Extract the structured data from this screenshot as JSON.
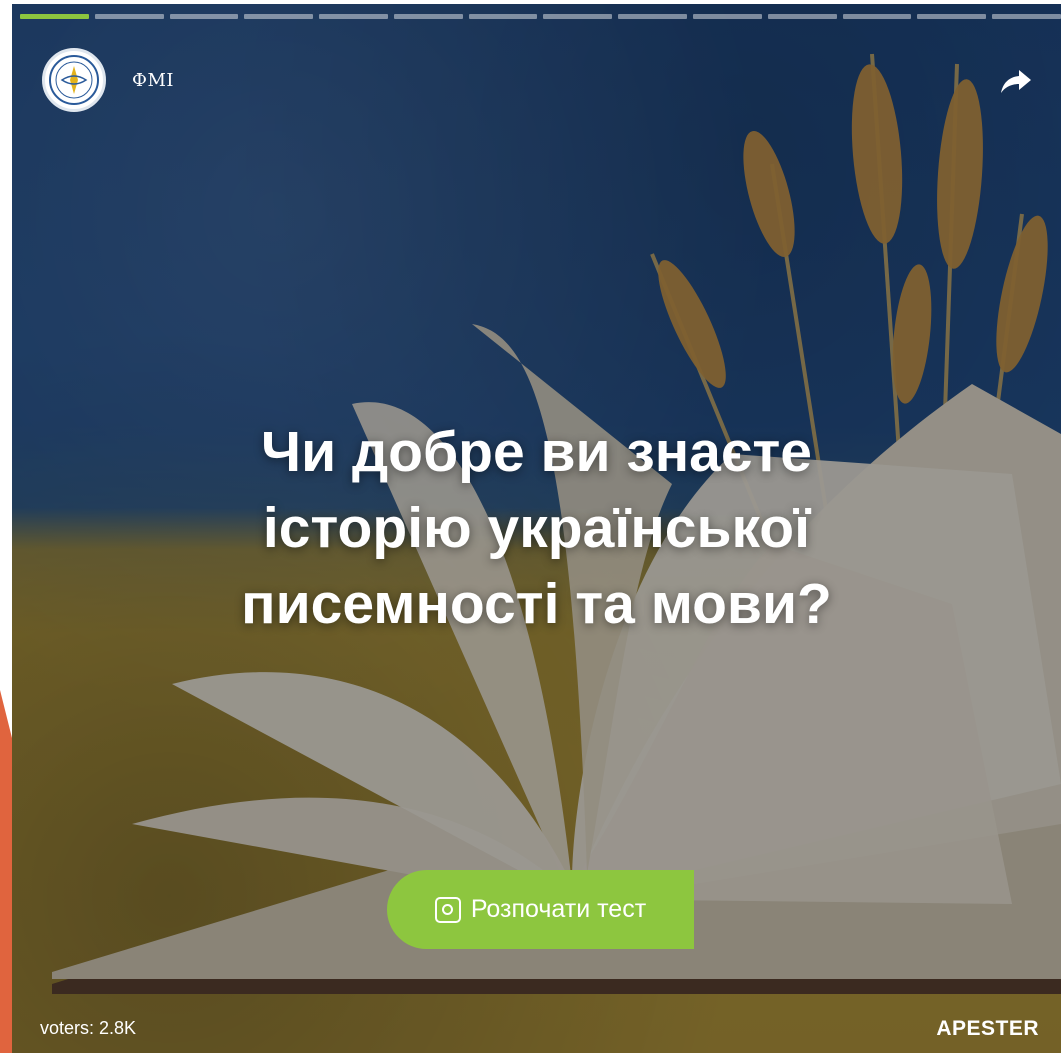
{
  "header": {
    "brand_name": "ФМІ",
    "avatar_icon": "university-seal-icon",
    "share_icon": "share-arrow-icon"
  },
  "progress": {
    "total_steps": 14,
    "current_step": 1,
    "active_color": "#8dc63f"
  },
  "quiz": {
    "title_lines": [
      "Чи добре ви знаєте",
      "історію української",
      "писемності та мови?"
    ],
    "start_button_label": "Розпочати тест",
    "start_button_icon": "quiz-start-icon",
    "accent_color": "#8dc63f"
  },
  "footer": {
    "voters_label": "voters: 2.8K",
    "brand_logo": "APESTER"
  },
  "colors": {
    "slide_accent": "#e0643e"
  }
}
